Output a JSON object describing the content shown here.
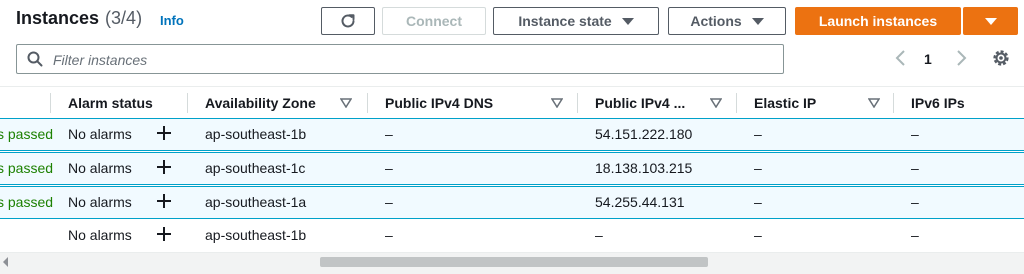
{
  "header": {
    "title": "Instances",
    "count": "(3/4)",
    "info_link": "Info",
    "connect_label": "Connect",
    "instance_state_label": "Instance state",
    "actions_label": "Actions",
    "launch_label": "Launch instances"
  },
  "search": {
    "placeholder": "Filter instances",
    "value": ""
  },
  "pagination": {
    "current_page": "1"
  },
  "columns": [
    "Alarm status",
    "Availability Zone",
    "Public IPv4 DNS",
    "Public IPv4 ...",
    "Elastic IP",
    "IPv6 IPs"
  ],
  "rows": [
    {
      "status_check": "s passed",
      "alarm": "No alarms",
      "zone": "ap-southeast-1b",
      "dns": "–",
      "ipv4": "54.151.222.180",
      "elastic": "–",
      "ipv6": "–",
      "selected": true
    },
    {
      "status_check": "s passed",
      "alarm": "No alarms",
      "zone": "ap-southeast-1c",
      "dns": "–",
      "ipv4": "18.138.103.215",
      "elastic": "–",
      "ipv6": "–",
      "selected": true
    },
    {
      "status_check": "s passed",
      "alarm": "No alarms",
      "zone": "ap-southeast-1a",
      "dns": "–",
      "ipv4": "54.255.44.131",
      "elastic": "–",
      "ipv6": "–",
      "selected": true
    },
    {
      "status_check": "",
      "alarm": "No alarms",
      "zone": "ap-southeast-1b",
      "dns": "–",
      "ipv4": "–",
      "elastic": "–",
      "ipv6": "–",
      "selected": false
    }
  ],
  "icons": [
    "refresh-icon",
    "caret-down-icon",
    "search-icon",
    "chevron-left-icon",
    "chevron-right-icon",
    "gear-icon",
    "filter-triangle-icon",
    "plus-icon"
  ],
  "colors": {
    "primary": "#ec7211",
    "link": "#0073bb",
    "success": "#1d8102",
    "selected_row_bg": "#f1faff",
    "selected_row_border": "#00a1c9"
  }
}
